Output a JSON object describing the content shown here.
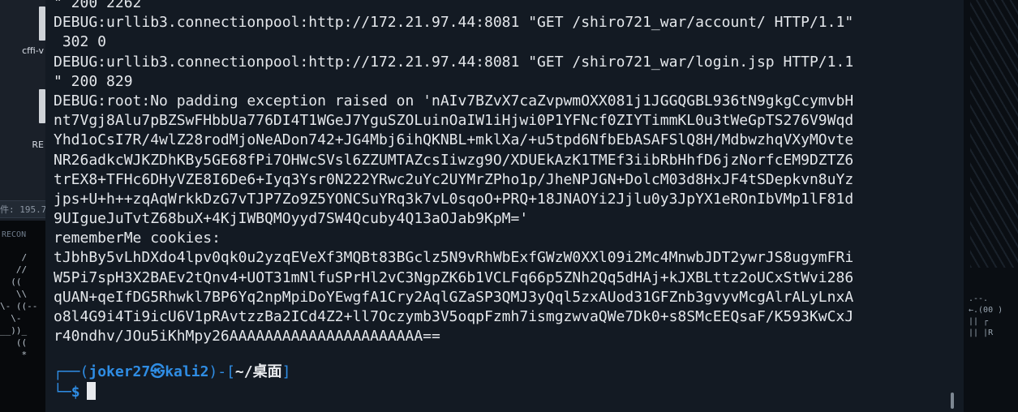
{
  "desktop": {
    "items": [
      {
        "label": "cffi-v"
      },
      {
        "label": "RE"
      }
    ],
    "path_fragment": "件: 195.7",
    "recon_label": "RECON"
  },
  "terminal": {
    "lines": [
      "\" 200 2262",
      "DEBUG:urllib3.connectionpool:http://172.21.97.44:8081 \"GET /shiro721_war/account/ HTTP/1.1\"",
      " 302 0",
      "DEBUG:urllib3.connectionpool:http://172.21.97.44:8081 \"GET /shiro721_war/login.jsp HTTP/1.1",
      "\" 200 829",
      "DEBUG:root:No padding exception raised on 'nAIv7BZvX7caZvpwmOXX081j1JGGQGBL936tN9gkgCcymvbH",
      "nt7Vgj8Alu7pBZSwFHbbUa776DI4T1WGeJ7YguSZOLuinOaIW1iHjwi0P1YFNcf0ZIYTimmKL0u3tWeGpTS276V9Wqd",
      "Yhd1oCsI7R/4wlZ28rodMjoNeADon742+JG4Mbj6ihQKNBL+mklXa/+u5tpd6NfbEbASAFSlQ8H/MdbwzhqVXyMOvte",
      "NR26adkcWJKZDhKBy5GE68fPi7OHWcSVsl6ZZUMTAZcsIiwzg9O/XDUEkAzK1TMEf3iibRbHhfD6jzNorfcEM9DZTZ6",
      "trEX8+TFHc6DHyVZE8I6De6+Iyq3Ysr0N222YRwc2uYc2UYMrZPho1p/JheNPJGN+DolcM03d8HxJF4tSDepkvn8uYz",
      "jps+U+h++zqAqWrkkDzG7vTJP7Zo9Z5YONCSuYRq3k7vL0sqoO+PRQ+18JNAOYi2Jjlu0y3JpYX1eROnIbVMp1lF81d",
      "9UIgueJuTvtZ68buX+4KjIWBQMOyyd7SW4Qcuby4Q13aOJab9KpM='",
      "rememberMe cookies:",
      "tJbhBy5vLhDXdo4lpv0qk0u2yzqEVeXf3MQBt83BGclz5N9vRhWbExfGWzW0XXl09i2Mc4MnwbJDT2ywrJS8ugymFRi",
      "W5Pi7spH3X2BAEv2tQnv4+UOT31mNlfuSPrHl2vC3NgpZK6b1VCLFq66p5ZNh2Qq5dHAj+kJXBLttz2oUCxStWvi286",
      "qUAN+qeIfDG5Rhwkl7BP6Yq2npMpiDoYEwgfA1Cry2AqlGZaSP3QMJ3yQql5zxAUod31GFZnb3gvyvMcgAlrALyLnxA",
      "o8l4G9i4Ti9icU6V1pRAvtzzBa2ICd4Z2+ll7Oczymb3V5oqpFzmh7ismgzwvaQWe7Dk0+s8SMcEEQsaF/K593KwCxJ",
      "r40ndhv/JOu5iKhMpy26AAAAAAAAAAAAAAAAAAAAAA=="
    ],
    "prompt": {
      "open": "┌──(",
      "user": "joker27㉿kali2",
      "mid": ")-[",
      "dir": "~/桌面",
      "close": "]",
      "corner": "└─",
      "dollar": "$"
    }
  },
  "colors": {
    "prompt_blue": "#2f8de4",
    "text": "#e4e7eb",
    "background": "#141a23"
  }
}
